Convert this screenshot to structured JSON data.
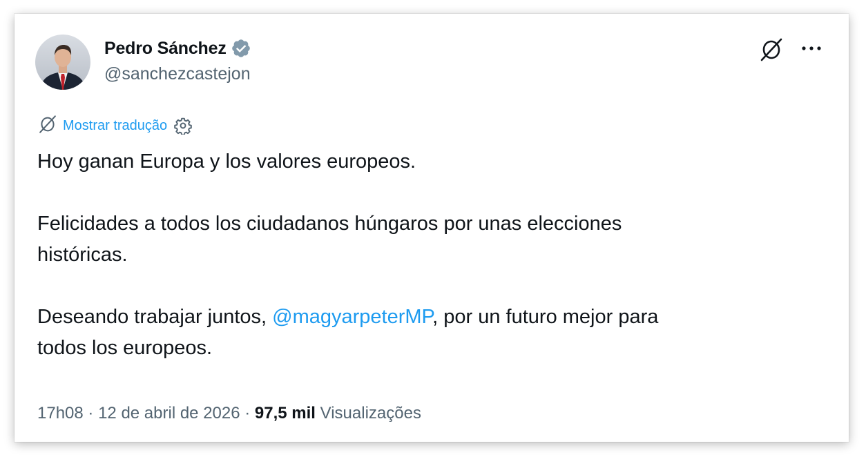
{
  "author": {
    "display_name": "Pedro Sánchez",
    "handle": "@sanchezcastejon",
    "verified_icon": "verified-badge-icon",
    "avatar_icon": "profile-photo"
  },
  "header_actions": {
    "grok_icon": "grok-icon",
    "more_icon": "more-dots-icon"
  },
  "translate": {
    "icon": "grok-icon",
    "label": "Mostrar tradução",
    "settings_icon": "gear-icon"
  },
  "tweet": {
    "line1": "Hoy ganan Europa y los valores europeos.",
    "para2_line1": "Felicidades a todos los ciudadanos húngaros por unas elecciones",
    "para2_line2": "históricas.",
    "para3_before": "Deseando trabajar juntos, ",
    "mention": "@magyarpeterMP",
    "para3_after": ", por un futuro mejor para",
    "para3_line2": "todos los europeos."
  },
  "meta": {
    "time": "17h08",
    "separator1": " · ",
    "date": "12 de abril de 2026",
    "separator2": " · ",
    "views_count": "97,5 mil",
    "views_label": " Visualizações"
  },
  "colors": {
    "text": "#0f1419",
    "secondary": "#536471",
    "link": "#1d9bf0",
    "verified": "#829aab"
  }
}
